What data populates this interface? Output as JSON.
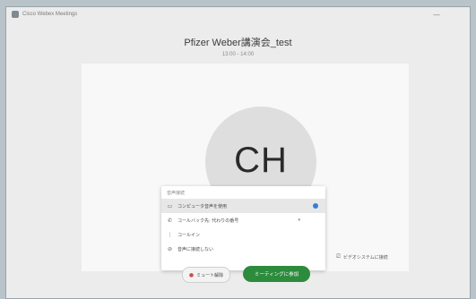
{
  "window": {
    "title": "Cisco Webex Meetings",
    "minimize_glyph": "—"
  },
  "meeting": {
    "title": "Pfizer Weber講演会_test",
    "time": "13:00 - 14:00"
  },
  "avatar": {
    "initials": "CH"
  },
  "audio_menu": {
    "header": "音声接続",
    "items": [
      {
        "label": "コンピュータ音声を使用",
        "icon": "computer-icon",
        "selected": true
      },
      {
        "label": "コールバック先: 代わりの番号",
        "icon": "phone-icon",
        "selected": false
      },
      {
        "label": "コールイン",
        "icon": "dialpad-icon",
        "selected": false
      },
      {
        "label": "音声に接続しない",
        "icon": "mute-icon",
        "selected": false
      }
    ]
  },
  "side_option": {
    "label": "ビデオシステムに接続"
  },
  "buttons": {
    "leave_label": "ミュート解除",
    "join_label": "ミーティングに参加"
  },
  "colors": {
    "accent": "#3a7bd5",
    "join_button": "#2d8b3d",
    "leave_icon": "#d04c4c"
  }
}
